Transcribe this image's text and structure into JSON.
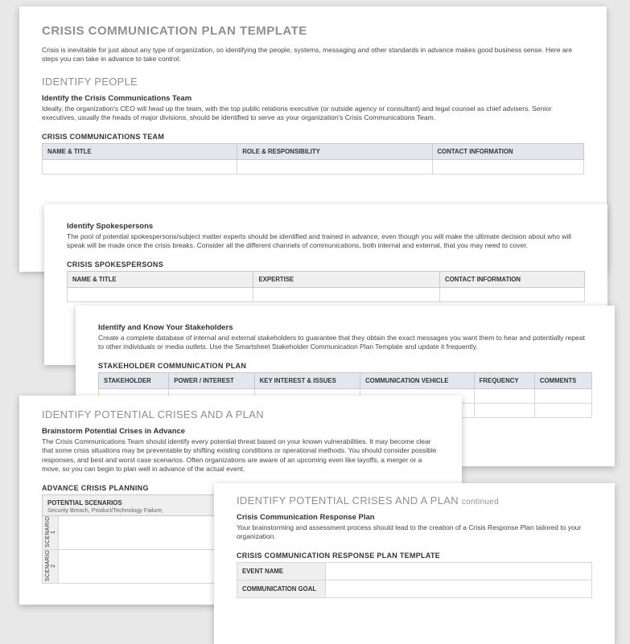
{
  "page1": {
    "title": "CRISIS COMMUNICATION PLAN TEMPLATE",
    "intro": "Crisis is inevitable for just about any type of organization, so identifying the people, systems, messaging and other standards in advance makes good business sense. Here are steps you can take in advance to take control:",
    "section": "IDENTIFY PEOPLE",
    "subhead": "Identify the Crisis Communications Team",
    "body": "Ideally, the organization's CEO will head up the team, with the top public relations executive (or outside agency or consultant) and legal counsel as chief advisers. Senior executives, usually the heads of major divisions, should be identified to serve as your organization's Crisis Communications Team.",
    "table_title": "CRISIS COMMUNICATIONS TEAM",
    "cols": {
      "c1": "NAME & TITLE",
      "c2": "ROLE & RESPONSIBILITY",
      "c3": "CONTACT INFORMATION"
    }
  },
  "page2": {
    "subhead": "Identify Spokespersons",
    "body": "The pool of potential spokespersons/subject matter experts should be identified and trained in advance, even though you will make the ultimate decision about who will speak will be made once the crisis breaks. Consider all the different channels of communications, both internal and external, that you may need to cover.",
    "table_title": "CRISIS SPOKESPERSONS",
    "cols": {
      "c1": "NAME & TITLE",
      "c2": "EXPERTISE",
      "c3": "CONTACT INFORMATION"
    }
  },
  "page3": {
    "subhead": "Identify and Know Your Stakeholders",
    "body": "Create a complete database of internal and external stakeholders to guarantee that they obtain the exact messages you want them to hear and potentially repeat to other individuals or media outlets. Use the Smartsheet Stakeholder Communication Plan Template and update it frequently.",
    "table_title": "STAKEHOLDER COMMUNICATION PLAN",
    "cols": {
      "c1": "STAKEHOLDER",
      "c2": "POWER / INTEREST",
      "c3": "KEY INTEREST & ISSUES",
      "c4": "COMMUNICATION VEHICLE",
      "c5": "FREQUENCY",
      "c6": "COMMENTS"
    }
  },
  "page4": {
    "section": "IDENTIFY POTENTIAL CRISES AND A PLAN",
    "subhead": "Brainstorm Potential Crises in Advance",
    "body": "The Crisis Communications Team should identify every potential threat based on your known vulnerabilities. It may become clear that some crisis situations may be preventable by shifting existing conditions or operational methods. You should consider possible responses, and best and worst case scenarios. Often organizations are aware of an upcoming even like layoffs, a merger or a move, so you can begin to plan well in advance of the actual event.",
    "table_title": "ADVANCE CRISIS PLANNING",
    "row_header": "POTENTIAL SCENARIOS",
    "row_sub": "Security Breach, Product/Technology Failure,",
    "scenario1": "SCENARIO 1",
    "scenario2": "SCENARIO 2"
  },
  "page5": {
    "section": "IDENTIFY POTENTIAL CRISES AND A PLAN",
    "continued": "continued",
    "subhead": "Crisis Communication Response Plan",
    "body": "Your brainstorming and assessment process should lead to the creation of a Crisis Response Plan tailored to your organization.",
    "table_title": "CRISIS COMMUNICATION RESPONSE PLAN TEMPLATE",
    "rows": {
      "r1": "EVENT NAME",
      "r2": "COMMUNICATION GOAL"
    }
  }
}
